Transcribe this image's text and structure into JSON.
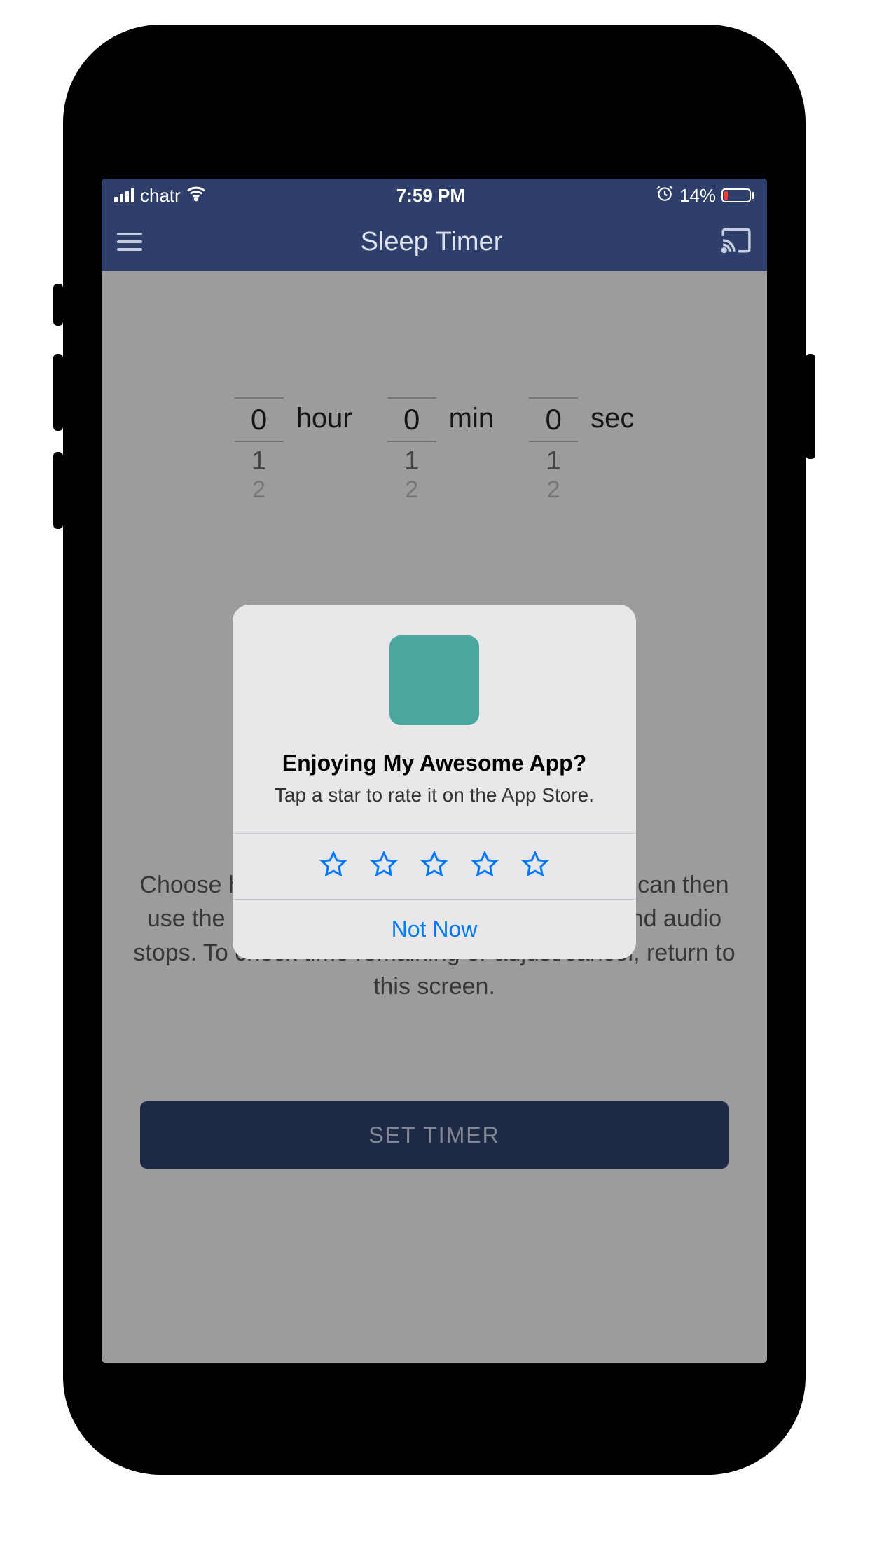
{
  "statusBar": {
    "carrier": "chatr",
    "time": "7:59 PM",
    "batteryPercent": "14%"
  },
  "nav": {
    "title": "Sleep Timer"
  },
  "pickers": {
    "hour": {
      "value": "0",
      "next": "1",
      "next2": "2",
      "label": "hour"
    },
    "min": {
      "value": "0",
      "next": "1",
      "next2": "2",
      "label": "min"
    },
    "sec": {
      "value": "0",
      "next": "1",
      "next2": "2",
      "label": "sec"
    }
  },
  "helpText": "Choose how long before the audio sleeps. You can then use the app normally until the timer runs out and audio stops. To check time remaining or adjust/cancel, return to this screen.",
  "setTimerLabel": "SET TIMER",
  "dialog": {
    "title": "Enjoying My Awesome App?",
    "subtitle": "Tap a star to rate it on the App Store.",
    "cancelLabel": "Not Now"
  },
  "colors": {
    "navBg": "#2d3f6a",
    "iosBlue": "#007aff",
    "appIcon": "#4aa8a0"
  }
}
